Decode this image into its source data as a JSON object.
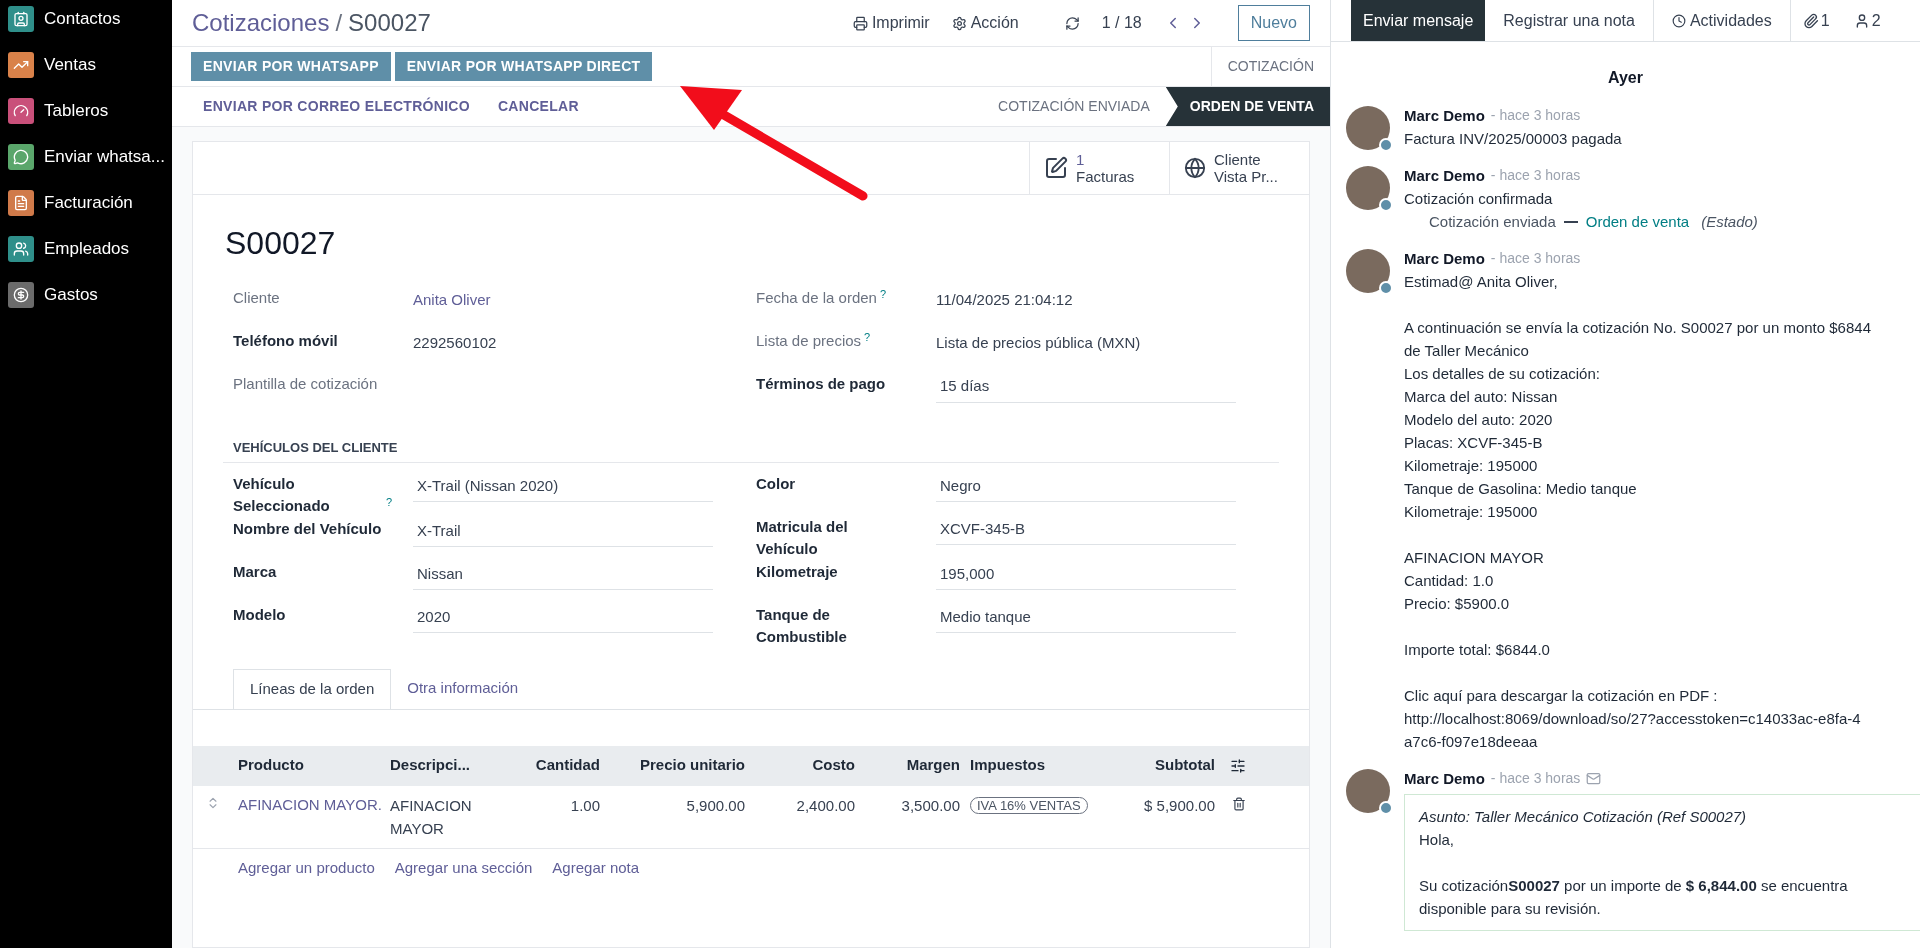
{
  "sidebar": {
    "items": [
      {
        "label": "Contactos",
        "color": "#2f8f8a"
      },
      {
        "label": "Ventas",
        "color": "#d9824a"
      },
      {
        "label": "Tableros",
        "color": "#c9507a"
      },
      {
        "label": "Enviar whatsa...",
        "color": "#5aa66b"
      },
      {
        "label": "Facturación",
        "color": "#d07a4a"
      },
      {
        "label": "Empleados",
        "color": "#2f8f8a"
      },
      {
        "label": "Gastos",
        "color": "#6b6b6b"
      }
    ]
  },
  "header": {
    "breadcrumb": "Cotizaciones",
    "separator": "/",
    "record": "S00027",
    "actions": [
      {
        "kind": "print",
        "label": "Imprimir"
      },
      {
        "kind": "gear",
        "label": "Acción"
      }
    ],
    "pager": "1 / 18",
    "new_button": "Nuevo"
  },
  "control_rows": [
    {
      "buttons": [
        {
          "label": "ENVIAR POR WHATSAPP",
          "primary": true
        },
        {
          "label": "ENVIAR POR WHATSAPP DIRECT",
          "primary": true
        }
      ],
      "statuses": [
        {
          "label": "COTIZACIÓN",
          "selected": false
        }
      ]
    },
    {
      "buttons": [
        {
          "label": "ENVIAR POR CORREO ELECTRÓNICO",
          "primary": false
        },
        {
          "label": "CANCELAR",
          "primary": false
        }
      ],
      "statuses": [
        {
          "label": "COTIZACIÓN ENVIADA",
          "selected": false
        },
        {
          "label": "ORDEN DE VENTA",
          "selected": true
        }
      ]
    }
  ],
  "stat_buttons": [
    {
      "kind": "invoice",
      "count": "1",
      "label": "Facturas"
    },
    {
      "kind": "globe",
      "title": "Cliente",
      "label": "Vista Pr..."
    }
  ],
  "form": {
    "name": "S00027",
    "fields_left": [
      {
        "label": "Cliente",
        "required": false,
        "value": "Anita Oliver",
        "kind": "link"
      },
      {
        "label": "Teléfono móvil",
        "required": true,
        "value": "2292560102",
        "kind": "text"
      },
      {
        "label": "Plantilla de cotización",
        "required": false,
        "kind": "empty"
      }
    ],
    "fields_right": [
      {
        "label": "Fecha de la orden",
        "required": false,
        "help_mark": "?",
        "value": "11/04/2025 21:04:12",
        "kind": "text"
      },
      {
        "label": "Lista de precios",
        "required": false,
        "help_mark": "?",
        "value": "Lista de precios pública (MXN)",
        "kind": "text"
      },
      {
        "label": "Términos de pago",
        "required": true,
        "value": "15 días",
        "kind": "input"
      }
    ],
    "section_title": "VEHÍCULOS DEL CLIENTE",
    "vehicle_left": [
      {
        "label": "Vehículo Seleccionado",
        "required": true,
        "help_mark": "?",
        "value": "X-Trail (Nissan 2020)",
        "kind": "input"
      },
      {
        "label": "Nombre del Vehículo",
        "required": true,
        "value": "X-Trail",
        "kind": "input"
      },
      {
        "label": "Marca",
        "required": true,
        "value": "Nissan",
        "kind": "input"
      },
      {
        "label": "Modelo",
        "required": true,
        "value": "2020",
        "kind": "input"
      }
    ],
    "vehicle_right": [
      {
        "label": "Color",
        "required": true,
        "value": "Negro",
        "kind": "input"
      },
      {
        "label": "Matricula del Vehículo",
        "required": true,
        "value": "XCVF-345-B",
        "kind": "input"
      },
      {
        "label": "Kilometraje",
        "required": true,
        "value": "195,000",
        "kind": "input"
      },
      {
        "label": "Tanque de Combustible",
        "required": true,
        "value": "Medio tanque",
        "kind": "input"
      }
    ]
  },
  "tabs": [
    {
      "label": "Líneas de la orden",
      "selected": true
    },
    {
      "label": "Otra información",
      "selected": false
    }
  ],
  "table": {
    "columns": [
      "Producto",
      "Descripci...",
      "Cantidad",
      "Precio unitario",
      "Costo",
      "Margen",
      "Impuestos",
      "Subtotal"
    ],
    "rows": [
      {
        "cells": [
          {
            "kind": "link",
            "text": "AFINACION MAYOR."
          },
          {
            "kind": "text",
            "text": "AFINACION MAYOR"
          },
          {
            "kind": "text",
            "text": "1.00"
          },
          {
            "kind": "text",
            "text": "5,900.00"
          },
          {
            "kind": "text",
            "text": "2,400.00"
          },
          {
            "kind": "text",
            "text": "3,500.00"
          },
          {
            "kind": "tag",
            "text": "IVA 16% VENTAS"
          },
          {
            "kind": "text",
            "text": "$ 5,900.00"
          }
        ]
      }
    ],
    "links": [
      "Agregar un producto",
      "Agregar una sección",
      "Agregar nota"
    ]
  },
  "chatter": {
    "tabs": [
      {
        "kind": "message",
        "label": "Enviar mensaje",
        "selected": true
      },
      {
        "kind": "note",
        "label": "Registrar una nota",
        "selected": false
      },
      {
        "kind": "activities",
        "label": "Actividades",
        "selected": false
      }
    ],
    "counters": [
      {
        "kind": "attachments",
        "count": "1"
      },
      {
        "kind": "followers",
        "count": "2"
      }
    ],
    "date_separator": "Ayer",
    "messages": [
      {
        "kind": "text",
        "author": "Marc Demo",
        "time": "- hace 3 horas",
        "paragraphs": [
          [
            "Factura INV/2025/00003 pagada"
          ]
        ]
      },
      {
        "kind": "tracking",
        "author": "Marc Demo",
        "time": "- hace 3 horas",
        "paragraphs": [
          [
            "Cotización confirmada"
          ]
        ],
        "old_value": "Cotización enviada",
        "new_value": "Orden de venta",
        "field": "(Estado)"
      },
      {
        "kind": "text",
        "author": "Marc Demo",
        "time": "- hace 3 horas",
        "paragraphs": [
          [
            "Estimad@ Anita Oliver,"
          ],
          [
            "A continuación se envía la cotización No. S00027 por un monto $6844",
            "de Taller Mecánico",
            "Los detalles de su cotización:",
            "Marca del auto: Nissan",
            "Modelo del auto: 2020",
            "Placas: XCVF-345-B",
            "Kilometraje: 195000",
            "Tanque de Gasolina: Medio tanque",
            "Kilometraje: 195000"
          ],
          [
            "AFINACION MAYOR",
            "Cantidad: 1.0",
            "Precio: $5900.0"
          ],
          [
            "Importe total: $6844.0"
          ],
          [
            "Clic aquí para descargar la cotización en PDF :",
            "http://localhost:8069/download/so/27?accesstoken=c14033ac-e8fa-4",
            "a7c6-f097e18deeaa"
          ]
        ]
      },
      {
        "kind": "email",
        "author": "Marc Demo",
        "time": "- hace 3 horas",
        "subject": "Asunto: Taller Mecánico Cotización (Ref S00027)",
        "paragraphs": [
          [
            "Hola,"
          ],
          [
            "Su cotización**S00027** por un importe de **$ 6,844.00** se encuentra disponible para su revisión."
          ]
        ]
      }
    ]
  }
}
